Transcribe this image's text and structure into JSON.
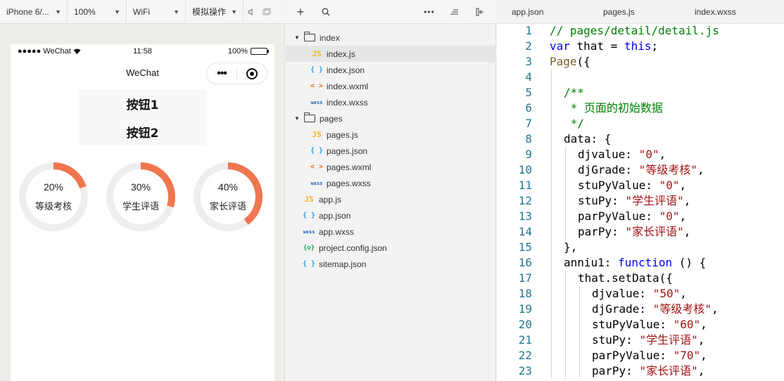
{
  "simulator": {
    "toolbar": {
      "device": "iPhone 6/...",
      "zoom": "100%",
      "network": "WiFi",
      "mode": "模拟操作"
    },
    "statusbar": {
      "carrier": "●●●●● WeChat",
      "time": "11:58",
      "battery": "100%"
    },
    "navbar": {
      "title": "WeChat"
    },
    "buttons": [
      "按钮1",
      "按钮2"
    ],
    "rings": [
      {
        "percent": "20%",
        "label": "等级考核",
        "value": 0.2
      },
      {
        "percent": "30%",
        "label": "学生评语",
        "value": 0.3
      },
      {
        "percent": "40%",
        "label": "家长评语",
        "value": 0.4
      }
    ],
    "colors": {
      "ring_progress": "#f07650",
      "ring_track": "#eeeeee"
    }
  },
  "explorer": {
    "tree": [
      {
        "type": "folder",
        "name": "index",
        "depth": 0
      },
      {
        "type": "js",
        "icon": "JS",
        "name": "index.js",
        "depth": 1,
        "selected": true
      },
      {
        "type": "json",
        "icon": "{ }",
        "name": "index.json",
        "depth": 1
      },
      {
        "type": "wxml",
        "icon": "< >",
        "name": "index.wxml",
        "depth": 1
      },
      {
        "type": "wxss",
        "icon": "wxss",
        "name": "index.wxss",
        "depth": 1
      },
      {
        "type": "folder",
        "name": "pages",
        "depth": 0
      },
      {
        "type": "js",
        "icon": "JS",
        "name": "pages.js",
        "depth": 1
      },
      {
        "type": "json",
        "icon": "{ }",
        "name": "pages.json",
        "depth": 1
      },
      {
        "type": "wxml",
        "icon": "< >",
        "name": "pages.wxml",
        "depth": 1
      },
      {
        "type": "wxss",
        "icon": "wxss",
        "name": "pages.wxss",
        "depth": 1
      },
      {
        "type": "js",
        "icon": "JS",
        "name": "app.js",
        "depth": 0
      },
      {
        "type": "json",
        "icon": "{ }",
        "name": "app.json",
        "depth": 0
      },
      {
        "type": "wxss",
        "icon": "wxss",
        "name": "app.wxss",
        "depth": 0
      },
      {
        "type": "config",
        "icon": "{o}",
        "name": "project.config.json",
        "depth": 0
      },
      {
        "type": "json",
        "icon": "{ }",
        "name": "sitemap.json",
        "depth": 0
      }
    ]
  },
  "editor": {
    "tabs": [
      "app.json",
      "pages.js",
      "index.wxss"
    ],
    "lines": [
      {
        "n": "1",
        "indent": 0,
        "tokens": [
          [
            "c",
            "// pages/detail/detail.js"
          ]
        ]
      },
      {
        "n": "2",
        "indent": 0,
        "tokens": [
          [
            "k",
            "var"
          ],
          [
            "p",
            " that = "
          ],
          [
            "k",
            "this"
          ],
          [
            "p",
            ";"
          ]
        ]
      },
      {
        "n": "3",
        "indent": 0,
        "tokens": [
          [
            "f",
            "Page"
          ],
          [
            "p",
            "({"
          ]
        ]
      },
      {
        "n": "4",
        "indent": 0,
        "tokens": []
      },
      {
        "n": "5",
        "indent": 1,
        "tokens": [
          [
            "c",
            "/**"
          ]
        ]
      },
      {
        "n": "6",
        "indent": 1,
        "tokens": [
          [
            "c",
            " * 页面的初始数据"
          ]
        ]
      },
      {
        "n": "7",
        "indent": 1,
        "tokens": [
          [
            "c",
            " */"
          ]
        ]
      },
      {
        "n": "8",
        "indent": 1,
        "tokens": [
          [
            "p",
            "data: {"
          ]
        ]
      },
      {
        "n": "9",
        "indent": 2,
        "tokens": [
          [
            "p",
            "djvalue: "
          ],
          [
            "s",
            "\"0\""
          ],
          [
            "p",
            ","
          ]
        ]
      },
      {
        "n": "10",
        "indent": 2,
        "tokens": [
          [
            "p",
            "djGrade: "
          ],
          [
            "s",
            "\"等级考核\""
          ],
          [
            "p",
            ","
          ]
        ]
      },
      {
        "n": "11",
        "indent": 2,
        "tokens": [
          [
            "p",
            "stuPyValue: "
          ],
          [
            "s",
            "\"0\""
          ],
          [
            "p",
            ","
          ]
        ]
      },
      {
        "n": "12",
        "indent": 2,
        "tokens": [
          [
            "p",
            "stuPy: "
          ],
          [
            "s",
            "\"学生评语\""
          ],
          [
            "p",
            ","
          ]
        ]
      },
      {
        "n": "13",
        "indent": 2,
        "tokens": [
          [
            "p",
            "parPyValue: "
          ],
          [
            "s",
            "\"0\""
          ],
          [
            "p",
            ","
          ]
        ]
      },
      {
        "n": "14",
        "indent": 2,
        "tokens": [
          [
            "p",
            "parPy: "
          ],
          [
            "s",
            "\"家长评语\""
          ],
          [
            "p",
            ","
          ]
        ]
      },
      {
        "n": "15",
        "indent": 1,
        "tokens": [
          [
            "p",
            "},"
          ]
        ]
      },
      {
        "n": "16",
        "indent": 1,
        "tokens": [
          [
            "p",
            "anniu1: "
          ],
          [
            "k",
            "function"
          ],
          [
            "p",
            " () {"
          ]
        ]
      },
      {
        "n": "17",
        "indent": 2,
        "tokens": [
          [
            "p",
            "that.setData({"
          ]
        ]
      },
      {
        "n": "18",
        "indent": 3,
        "tokens": [
          [
            "p",
            "djvalue: "
          ],
          [
            "s",
            "\"50\""
          ],
          [
            "p",
            ","
          ]
        ]
      },
      {
        "n": "19",
        "indent": 3,
        "tokens": [
          [
            "p",
            "djGrade: "
          ],
          [
            "s",
            "\"等级考核\""
          ],
          [
            "p",
            ","
          ]
        ]
      },
      {
        "n": "20",
        "indent": 3,
        "tokens": [
          [
            "p",
            "stuPyValue: "
          ],
          [
            "s",
            "\"60\""
          ],
          [
            "p",
            ","
          ]
        ]
      },
      {
        "n": "21",
        "indent": 3,
        "tokens": [
          [
            "p",
            "stuPy: "
          ],
          [
            "s",
            "\"学生评语\""
          ],
          [
            "p",
            ","
          ]
        ]
      },
      {
        "n": "22",
        "indent": 3,
        "tokens": [
          [
            "p",
            "parPyValue: "
          ],
          [
            "s",
            "\"70\""
          ],
          [
            "p",
            ","
          ]
        ]
      },
      {
        "n": "23",
        "indent": 3,
        "tokens": [
          [
            "p",
            "parPy: "
          ],
          [
            "s",
            "\"家长评语\""
          ],
          [
            "p",
            ","
          ]
        ]
      }
    ]
  }
}
